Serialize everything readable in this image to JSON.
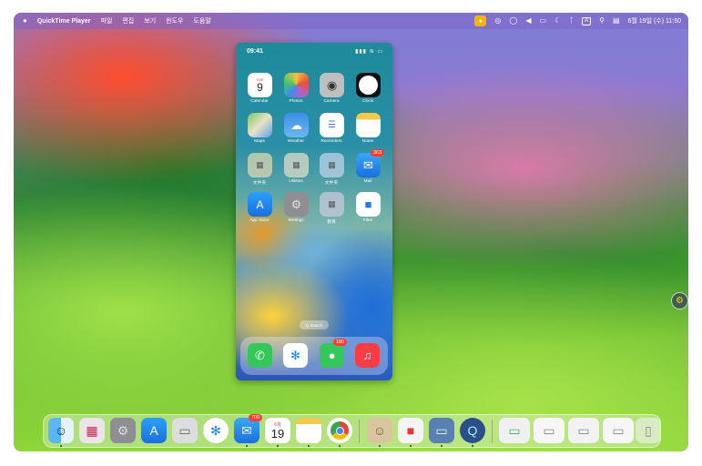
{
  "menubar": {
    "apple": "",
    "app_name": "QuickTime Player",
    "menus": [
      "파일",
      "편집",
      "보기",
      "윈도우",
      "도움말"
    ],
    "input_indicator": "A",
    "datetime": "6월 19일 (수)  11:50"
  },
  "phone": {
    "time": "09:41",
    "status": "▮▮▮ ≋ ▭",
    "calendar_day": "TUE",
    "calendar_date": "9",
    "apps": [
      {
        "label": "Calendar",
        "icon": "calendar-icon"
      },
      {
        "label": "Photos",
        "icon": "photos-icon"
      },
      {
        "label": "Camera",
        "icon": "camera-icon"
      },
      {
        "label": "Clock",
        "icon": "clock-icon"
      },
      {
        "label": "Maps",
        "icon": "maps-icon"
      },
      {
        "label": "Weather",
        "icon": "weather-icon"
      },
      {
        "label": "Reminders",
        "icon": "reminders-icon"
      },
      {
        "label": "Notes",
        "icon": "notes-icon"
      },
      {
        "label": "文件夹",
        "icon": "folder-icon"
      },
      {
        "label": "Utilities",
        "icon": "folder-icon"
      },
      {
        "label": "文件夹",
        "icon": "folder-icon"
      },
      {
        "label": "Mail",
        "icon": "mail-icon"
      },
      {
        "label": "App Store",
        "icon": "app-store-icon"
      },
      {
        "label": "Settings",
        "icon": "settings-icon"
      },
      {
        "label": "教育",
        "icon": "folder-icon"
      },
      {
        "label": "Files",
        "icon": "files-icon"
      }
    ],
    "mail_badge": "363",
    "search_label": "Q Search",
    "dock_messages_badge": "180"
  },
  "dock": {
    "mail_badge": "700",
    "calendar_month": "6월",
    "calendar_date": "19"
  },
  "colors": {
    "badge": "#ff3b30",
    "mic": "#f4b400"
  }
}
